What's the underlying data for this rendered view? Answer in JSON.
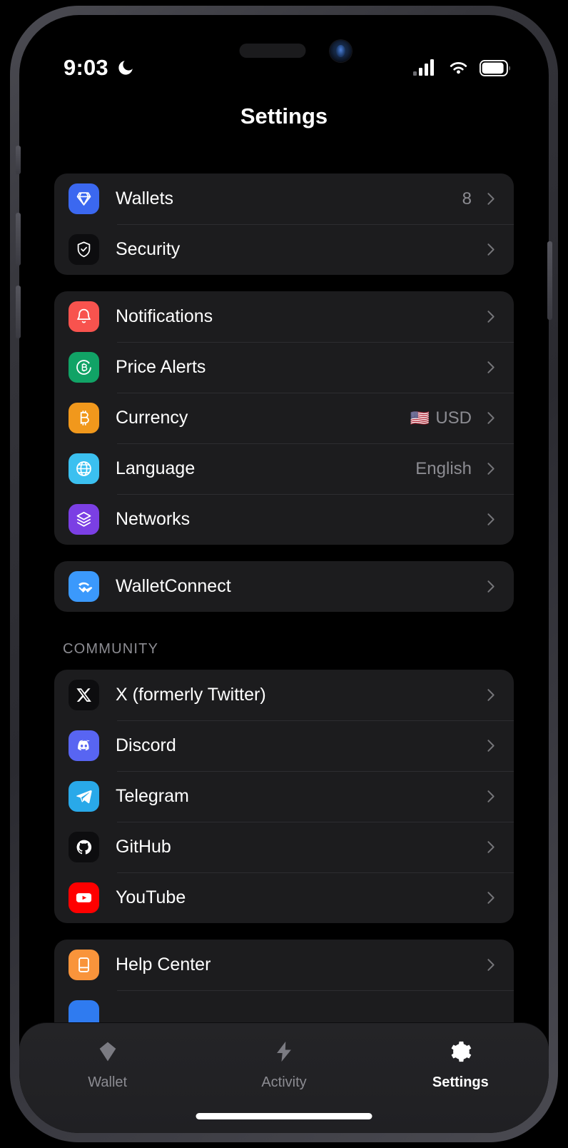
{
  "status_bar": {
    "time": "9:03",
    "dnd_icon": "moon-icon",
    "cellular_icon": "cellular-signal-icon",
    "wifi_icon": "wifi-icon",
    "battery_icon": "battery-icon"
  },
  "header": {
    "title": "Settings"
  },
  "colors": {
    "card_bg": "#1c1c1e",
    "screen_bg": "#000000",
    "separator": "#2d2d30",
    "secondary_text": "#8c8c92",
    "wallets": "#3b68f0",
    "security": "#0d0d0f",
    "notifications": "#f8534e",
    "price_alerts": "#11a366",
    "currency": "#f1981c",
    "language": "#3bc0f0",
    "networks": "#7b3fe4",
    "walletconnect": "#3b99fc",
    "x_twitter": "#0d0d0f",
    "discord": "#5865f2",
    "telegram": "#29a9e9",
    "github": "#0d0d0f",
    "youtube": "#ff0000",
    "help_center": "#f9943b"
  },
  "groups": [
    {
      "name": "account-group",
      "header": null,
      "rows": [
        {
          "label": "Wallets",
          "value": "8",
          "flag": null,
          "icon": "diamond-icon",
          "icon_color": "#3b68f0",
          "name": "wallets"
        },
        {
          "label": "Security",
          "value": null,
          "flag": null,
          "icon": "shield-check-icon",
          "icon_color": "#0d0d0f",
          "name": "security"
        }
      ]
    },
    {
      "name": "preferences-group",
      "header": null,
      "rows": [
        {
          "label": "Notifications",
          "value": null,
          "flag": null,
          "icon": "bell-icon",
          "icon_color": "#f8534e",
          "name": "notifications"
        },
        {
          "label": "Price Alerts",
          "value": null,
          "flag": null,
          "icon": "bitcoin-circle-icon",
          "icon_color": "#11a366",
          "name": "price-alerts"
        },
        {
          "label": "Currency",
          "value": "USD",
          "flag": "🇺🇸",
          "icon": "bitcoin-icon",
          "icon_color": "#f1981c",
          "name": "currency"
        },
        {
          "label": "Language",
          "value": "English",
          "flag": null,
          "icon": "globe-icon",
          "icon_color": "#3bc0f0",
          "name": "language"
        },
        {
          "label": "Networks",
          "value": null,
          "flag": null,
          "icon": "layers-icon",
          "icon_color": "#7b3fe4",
          "name": "networks"
        }
      ]
    },
    {
      "name": "walletconnect-group",
      "header": null,
      "rows": [
        {
          "label": "WalletConnect",
          "value": null,
          "flag": null,
          "icon": "walletconnect-icon",
          "icon_color": "#3b99fc",
          "name": "walletconnect"
        }
      ]
    },
    {
      "name": "community-group",
      "header": "COMMUNITY",
      "rows": [
        {
          "label": "X (formerly Twitter)",
          "value": null,
          "flag": null,
          "icon": "x-icon",
          "icon_color": "#0d0d0f",
          "name": "x-twitter"
        },
        {
          "label": "Discord",
          "value": null,
          "flag": null,
          "icon": "discord-icon",
          "icon_color": "#5865f2",
          "name": "discord"
        },
        {
          "label": "Telegram",
          "value": null,
          "flag": null,
          "icon": "telegram-icon",
          "icon_color": "#29a9e9",
          "name": "telegram"
        },
        {
          "label": "GitHub",
          "value": null,
          "flag": null,
          "icon": "github-icon",
          "icon_color": "#0d0d0f",
          "name": "github"
        },
        {
          "label": "YouTube",
          "value": null,
          "flag": null,
          "icon": "youtube-icon",
          "icon_color": "#ff0000",
          "name": "youtube"
        }
      ]
    },
    {
      "name": "support-group",
      "header": null,
      "rows": [
        {
          "label": "Help Center",
          "value": null,
          "flag": null,
          "icon": "book-icon",
          "icon_color": "#f9943b",
          "name": "help-center"
        },
        {
          "label": "",
          "value": null,
          "flag": null,
          "icon": "blue-icon",
          "icon_color": "#2f7bf0",
          "name": "partial-row"
        }
      ]
    }
  ],
  "tab_bar": {
    "items": [
      {
        "label": "Wallet",
        "icon": "diamond-icon",
        "active": false,
        "name": "tab-wallet"
      },
      {
        "label": "Activity",
        "icon": "lightning-icon",
        "active": false,
        "name": "tab-activity"
      },
      {
        "label": "Settings",
        "icon": "gear-icon",
        "active": true,
        "name": "tab-settings"
      }
    ]
  }
}
